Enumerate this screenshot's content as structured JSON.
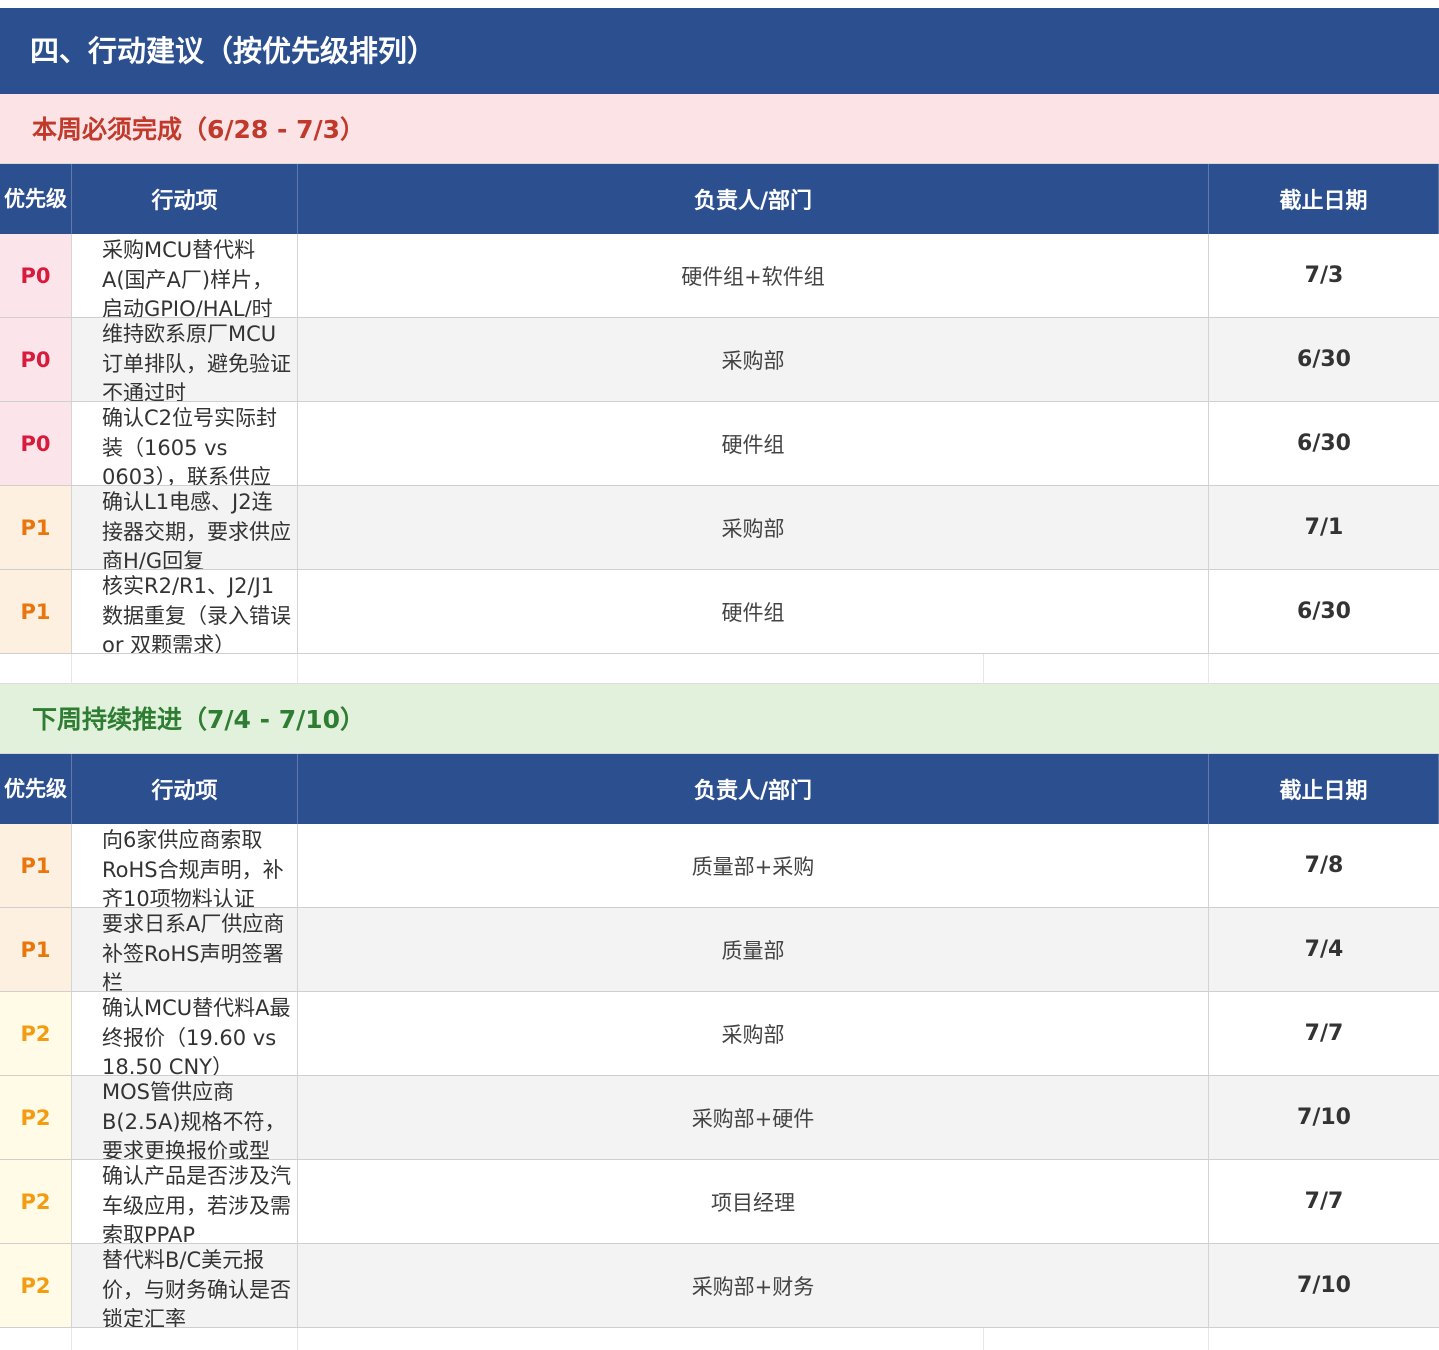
{
  "page_title": "四、行动建议（按优先级排列）",
  "columns": {
    "priority": "优先级",
    "action": "行动项",
    "owner": "负责人/部门",
    "deadline": "截止日期"
  },
  "sections": [
    {
      "title": "本周必须完成（6/28 - 7/3）",
      "rows": [
        {
          "priority": "P0",
          "action": "采购MCU替代料A(国产A厂)样片，启动GPIO/HAL/时",
          "owner": "硬件组+软件组",
          "deadline": "7/3"
        },
        {
          "priority": "P0",
          "action": "维持欧系原厂MCU订单排队，避免验证不通过时",
          "owner": "采购部",
          "deadline": "6/30"
        },
        {
          "priority": "P0",
          "action": "确认C2位号实际封装（1605 vs 0603），联系供应",
          "owner": "硬件组",
          "deadline": "6/30"
        },
        {
          "priority": "P1",
          "action": "确认L1电感、J2连接器交期，要求供应商H/G回复",
          "owner": "采购部",
          "deadline": "7/1"
        },
        {
          "priority": "P1",
          "action": "核实R2/R1、J2/J1数据重复（录入错误 or 双颗需求）",
          "owner": "硬件组",
          "deadline": "6/30"
        }
      ]
    },
    {
      "title": "下周持续推进（7/4 - 7/10）",
      "rows": [
        {
          "priority": "P1",
          "action": "向6家供应商索取RoHS合规声明，补齐10项物料认证",
          "owner": "质量部+采购",
          "deadline": "7/8"
        },
        {
          "priority": "P1",
          "action": "要求日系A厂供应商补签RoHS声明签署栏",
          "owner": "质量部",
          "deadline": "7/4"
        },
        {
          "priority": "P2",
          "action": "确认MCU替代料A最终报价（19.60 vs 18.50 CNY）",
          "owner": "采购部",
          "deadline": "7/7"
        },
        {
          "priority": "P2",
          "action": "MOS管供应商B(2.5A)规格不符，要求更换报价或型",
          "owner": "采购部+硬件",
          "deadline": "7/10"
        },
        {
          "priority": "P2",
          "action": "确认产品是否涉及汽车级应用，若涉及需索取PPAP",
          "owner": "项目经理",
          "deadline": "7/7"
        },
        {
          "priority": "P2",
          "action": "替代料B/C美元报价，与财务确认是否锁定汇率",
          "owner": "采购部+财务",
          "deadline": "7/10"
        }
      ]
    }
  ],
  "colors": {
    "header_bg": "#2b4f8f",
    "this_week_bg": "#fbe3e6",
    "this_week_text": "#c0392b",
    "next_week_bg": "#e1f1dc",
    "next_week_text": "#2e7d32",
    "p0": "#d81b3c",
    "p1": "#e8760c",
    "p2": "#f39c12"
  }
}
